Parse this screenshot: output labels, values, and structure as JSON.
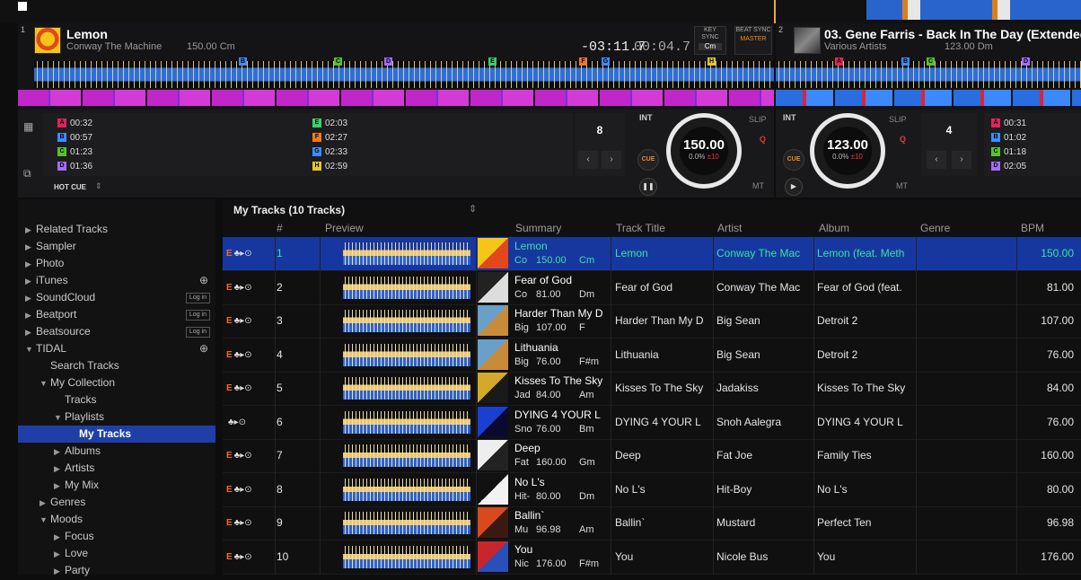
{
  "deck1": {
    "number": "1",
    "title": "Lemon",
    "artist": "Conway The Machine",
    "bpm_key": "150.00 Cm",
    "time_remaining": "-03:11.7",
    "time_elapsed": "00:04.7",
    "keysync_label": "KEY SYNC",
    "keysync_value": "Cm",
    "beatsync_label": "BEAT SYNC",
    "master_label": "MASTER",
    "bpm": "150.00",
    "pitch": "0.0%",
    "range": "±10",
    "hotcues_left": [
      {
        "letter": "A",
        "time": "00:32",
        "color": "#e0245e"
      },
      {
        "letter": "B",
        "time": "00:57",
        "color": "#3f8bff"
      },
      {
        "letter": "C",
        "time": "01:23",
        "color": "#57c22e"
      },
      {
        "letter": "D",
        "time": "01:36",
        "color": "#a66bff"
      }
    ],
    "hotcues_right": [
      {
        "letter": "E",
        "time": "02:03",
        "color": "#3ccf6a"
      },
      {
        "letter": "F",
        "time": "02:27",
        "color": "#f07a1e"
      },
      {
        "letter": "G",
        "time": "02:33",
        "color": "#3f8bff"
      },
      {
        "letter": "H",
        "time": "02:59",
        "color": "#e6c52a"
      }
    ],
    "hotcue_label": "HOT CUE",
    "loop_value": "8",
    "int_label": "INT",
    "slip_label": "SLIP",
    "q_label": "Q",
    "mt_label": "MT",
    "cue_label": "CUE"
  },
  "deck2": {
    "number": "2",
    "title": "03. Gene Farris - Back In The Day (Extended",
    "artist": "Various Artists",
    "bpm_key": "123.00 Dm",
    "bpm": "123.00",
    "pitch": "0.0%",
    "range": "±10",
    "hotcues": [
      {
        "letter": "A",
        "time": "00:31",
        "color": "#e0245e"
      },
      {
        "letter": "B",
        "time": "01:02",
        "color": "#3f8bff"
      },
      {
        "letter": "C",
        "time": "01:18",
        "color": "#57c22e"
      },
      {
        "letter": "D",
        "time": "02:05",
        "color": "#a66bff"
      }
    ],
    "loop_value": "4",
    "int_label": "INT",
    "slip_label": "SLIP",
    "q_label": "Q",
    "mt_label": "MT",
    "cue_label": "CUE"
  },
  "sidebar": {
    "items": [
      {
        "label": "Related Tracks",
        "indent": 0,
        "arrow": "▶"
      },
      {
        "label": "Sampler",
        "indent": 0,
        "arrow": "▶"
      },
      {
        "label": "Photo",
        "indent": 0,
        "arrow": "▶"
      },
      {
        "label": "iTunes",
        "indent": 0,
        "arrow": "▶"
      },
      {
        "label": "SoundCloud",
        "indent": 0,
        "arrow": "▶"
      },
      {
        "label": "Beatport",
        "indent": 0,
        "arrow": "▶"
      },
      {
        "label": "Beatsource",
        "indent": 0,
        "arrow": "▶"
      },
      {
        "label": "TIDAL",
        "indent": 0,
        "arrow": "▼"
      },
      {
        "label": "Search Tracks",
        "indent": 1,
        "arrow": ""
      },
      {
        "label": "My Collection",
        "indent": 1,
        "arrow": "▼"
      },
      {
        "label": "Tracks",
        "indent": 2,
        "arrow": ""
      },
      {
        "label": "Playlists",
        "indent": 2,
        "arrow": "▼"
      },
      {
        "label": "My Tracks",
        "indent": 3,
        "arrow": ""
      },
      {
        "label": "Albums",
        "indent": 2,
        "arrow": "▶"
      },
      {
        "label": "Artists",
        "indent": 2,
        "arrow": "▶"
      },
      {
        "label": "My Mix",
        "indent": 2,
        "arrow": "▶"
      },
      {
        "label": "Genres",
        "indent": 1,
        "arrow": "▶"
      },
      {
        "label": "Moods",
        "indent": 1,
        "arrow": "▼"
      },
      {
        "label": "Focus",
        "indent": 2,
        "arrow": "▶"
      },
      {
        "label": "Love",
        "indent": 2,
        "arrow": "▶"
      },
      {
        "label": "Party",
        "indent": 2,
        "arrow": "▶"
      }
    ],
    "login_label": "Log in"
  },
  "browser": {
    "title": "My Tracks (10 Tracks)",
    "columns": {
      "num": "#",
      "preview": "Preview",
      "summary": "Summary",
      "title": "Track Title",
      "artist": "Artist",
      "album": "Album",
      "genre": "Genre",
      "bpm": "BPM"
    },
    "rows": [
      {
        "num": "1",
        "title": "Lemon",
        "sum_artist": "Co",
        "bpm_short": "150.00",
        "key": "Cm",
        "artist": "Conway The Mac",
        "album": "Lemon (feat. Meth",
        "bpm": "150.00",
        "explicit": "E",
        "art": [
          "#f5c518",
          "#e2481b"
        ]
      },
      {
        "num": "2",
        "title": "Fear of God",
        "sum_artist": "Co",
        "bpm_short": "81.00",
        "key": "Dm",
        "artist": "Conway The Mac",
        "album": "Fear of God (feat.",
        "bpm": "81.00",
        "explicit": "E",
        "art": [
          "#222",
          "#ddd"
        ]
      },
      {
        "num": "3",
        "title": "Harder Than My D",
        "sum_artist": "Big",
        "bpm_short": "107.00",
        "key": "F",
        "artist": "Big Sean",
        "album": "Detroit 2",
        "bpm": "107.00",
        "explicit": "E",
        "art": [
          "#6aa0c8",
          "#c98a3a"
        ]
      },
      {
        "num": "4",
        "title": "Lithuania",
        "sum_artist": "Big",
        "bpm_short": "76.00",
        "key": "F#m",
        "artist": "Big Sean",
        "album": "Detroit 2",
        "bpm": "76.00",
        "explicit": "E",
        "art": [
          "#6aa0c8",
          "#c98a3a"
        ]
      },
      {
        "num": "5",
        "title": "Kisses To The Sky",
        "sum_artist": "Jad",
        "bpm_short": "84.00",
        "key": "Am",
        "artist": "Jadakiss",
        "album": "Kisses To The Sky",
        "bpm": "84.00",
        "explicit": "E",
        "art": [
          "#d4a82a",
          "#1a1a1a"
        ]
      },
      {
        "num": "6",
        "title": "DYING 4 YOUR L",
        "sum_artist": "Sno",
        "bpm_short": "76.00",
        "key": "Bm",
        "artist": "Snoh Aalegra",
        "album": "DYING 4 YOUR L",
        "bpm": "76.00",
        "explicit": "",
        "art": [
          "#1b3fd0",
          "#0a0a30"
        ]
      },
      {
        "num": "7",
        "title": "Deep",
        "sum_artist": "Fat",
        "bpm_short": "160.00",
        "key": "Gm",
        "artist": "Fat Joe",
        "album": "Family Ties",
        "bpm": "160.00",
        "explicit": "E",
        "art": [
          "#eee",
          "#222"
        ]
      },
      {
        "num": "8",
        "title": "No L's",
        "sum_artist": "Hit-",
        "bpm_short": "80.00",
        "key": "Dm",
        "artist": "Hit-Boy",
        "album": "No L's",
        "bpm": "80.00",
        "explicit": "E",
        "art": [
          "#111",
          "#f2f2f2"
        ]
      },
      {
        "num": "9",
        "title": "Ballin`",
        "sum_artist": "Mu",
        "bpm_short": "96.98",
        "key": "Am",
        "artist": "Mustard",
        "album": "Perfect Ten",
        "bpm": "96.98",
        "explicit": "E",
        "art": [
          "#d84a1e",
          "#3a1a10"
        ]
      },
      {
        "num": "10",
        "title": "You",
        "sum_artist": "Nic",
        "bpm_short": "176.00",
        "key": "F#m",
        "artist": "Nicole Bus",
        "album": "You",
        "bpm": "176.00",
        "explicit": "E",
        "art": [
          "#c8262c",
          "#2a4fb8"
        ]
      }
    ]
  },
  "colors": {
    "accent": "#1f3fa8",
    "selected_text": "#3de0a0",
    "cue": "#f08a1e",
    "explicit": "#f06a2a"
  }
}
